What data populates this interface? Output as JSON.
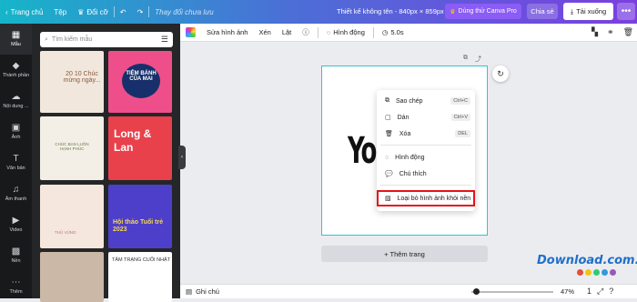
{
  "topbar": {
    "home": "Trang chủ",
    "file": "Tệp",
    "resize": "Đổi cỡ",
    "saved": "Thay đổi chưa lưu",
    "doc_title": "Thiết kế không tên - 840px × 859px",
    "pro": "Dùng thử Canva Pro",
    "share": "Chia sẻ",
    "download": "Tải xuống"
  },
  "rail": {
    "items": [
      "Mẫu",
      "Thành phần",
      "Nội dung ...",
      "Ảnh",
      "Văn bản",
      "Âm thanh",
      "Video",
      "Nền",
      "Thêm"
    ]
  },
  "panel": {
    "search_placeholder": "Tìm kiếm mẫu",
    "thumb1": "20 10 Chúc mừng ngày...",
    "thumb2": "TIỆM BÁNH CỦA MAI",
    "thumb3": "CHÚC BẠN LUÔN HẠNH PHÚC",
    "thumb4": "Long & Lan",
    "thumb5": "THỦ VŨNG",
    "thumb6": "Hội thảo Tuổi trẻ 2023",
    "thumb8": "TÂM TRẠNG CUỐI NHẬT"
  },
  "toolbar": {
    "edit_image": "Sửa hình ảnh",
    "crop": "Xén",
    "flip": "Lật",
    "animate": "Hình động",
    "duration": "5.0s"
  },
  "canvas": {
    "word": "You",
    "add_page": "+ Thêm trang"
  },
  "context_menu": {
    "copy": "Sao chép",
    "copy_kb": "Ctrl+C",
    "paste": "Dán",
    "paste_kb": "Ctrl+V",
    "delete": "Xóa",
    "delete_kb": "DEL",
    "animate": "Hình động",
    "comment": "Chú thích",
    "remove_bg": "Loại bỏ hình ảnh khỏi nền"
  },
  "bottombar": {
    "notes": "Ghi chú",
    "zoom": "47%",
    "page_count": "1"
  },
  "watermark": {
    "text": "Download.com.vn"
  }
}
